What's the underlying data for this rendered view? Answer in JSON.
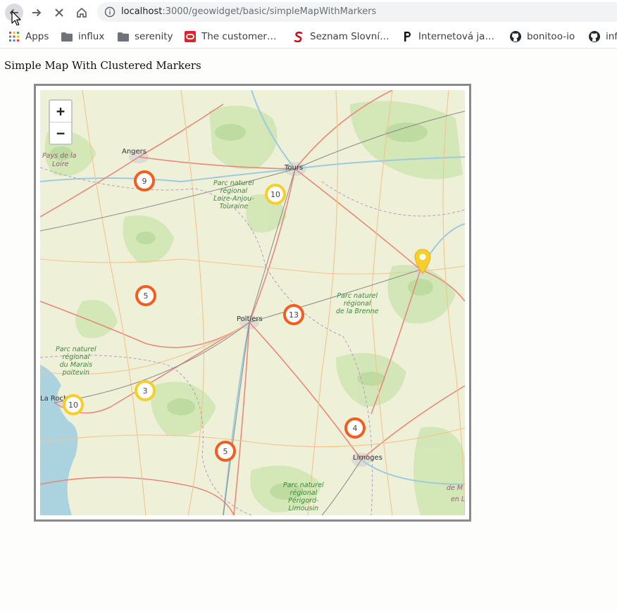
{
  "browser": {
    "url_host": "localhost",
    "url_path": ":3000/geowidget/basic/simpleMapWithMarkers",
    "bookmarks": [
      {
        "label": "Apps",
        "icon": "apps-grid-icon"
      },
      {
        "label": "influx",
        "icon": "folder-icon"
      },
      {
        "label": "serenity",
        "icon": "folder-icon"
      },
      {
        "label": "The customer…",
        "icon": "oracle-icon"
      },
      {
        "label": "Seznam Slovní…",
        "icon": "seznam-icon"
      },
      {
        "label": "Internetová ja…",
        "icon": "p-letter-icon"
      },
      {
        "label": "bonitoo-io",
        "icon": "github-icon"
      },
      {
        "label": "inf",
        "icon": "github-icon"
      }
    ]
  },
  "page": {
    "title": "Simple Map With Clustered Markers"
  },
  "map": {
    "zoom_in": "+",
    "zoom_out": "−",
    "clusters": [
      {
        "count": "9",
        "color": "red"
      },
      {
        "count": "10",
        "color": "yellow"
      },
      {
        "count": "5",
        "color": "red"
      },
      {
        "count": "13",
        "color": "red"
      },
      {
        "count": "3",
        "color": "yellow"
      },
      {
        "count": "10",
        "color": "yellow"
      },
      {
        "count": "4",
        "color": "red"
      },
      {
        "count": "5",
        "color": "red"
      }
    ],
    "cities": [
      "Angers",
      "Tours",
      "Poitiers",
      "La Roch",
      "Limoges"
    ],
    "regions": [
      "Pays de la",
      "Loire",
      "de M",
      "en L"
    ],
    "parks": [
      [
        "Parc naturel",
        "régional",
        "Loire-Anjou-",
        "Touraine"
      ],
      [
        "Parc naturel",
        "régional",
        "de la Brenne"
      ],
      [
        "Parc naturel",
        "régional",
        "du Marais",
        "poitevin"
      ],
      [
        "Parc naturel",
        "régional",
        "Périgord-",
        "Limousin"
      ]
    ],
    "colors": {
      "cluster_red": "#f05f1f",
      "cluster_yellow": "#f7cf2b",
      "pin": "#f7cf2b"
    }
  }
}
